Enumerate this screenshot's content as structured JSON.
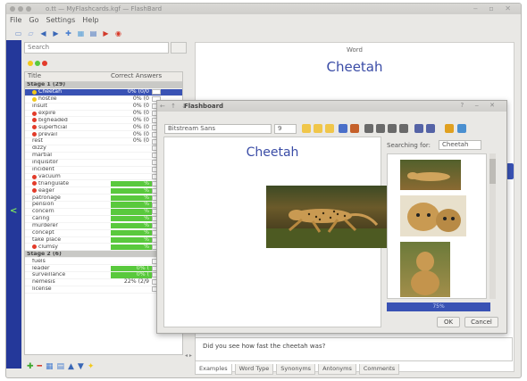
{
  "window": {
    "title": "o.tt — MyFlashcards.kgf — FlashBard"
  },
  "menu": [
    "File",
    "Go",
    "Settings",
    "Help"
  ],
  "toolbar": {
    "buttons": [
      {
        "icon": "new-doc-icon",
        "color": "#6f8fc9"
      },
      {
        "icon": "open-icon",
        "color": "#8aa5d6"
      },
      {
        "icon": "back-icon",
        "color": "#3a67b6"
      },
      {
        "icon": "forward-icon",
        "color": "#3a67b6"
      },
      {
        "icon": "add-card-icon",
        "color": "#4a7fd0"
      },
      {
        "icon": "grid-icon",
        "color": "#5aa0d8"
      },
      {
        "icon": "deck-icon",
        "color": "#3f6fc0"
      },
      {
        "icon": "play-icon",
        "color": "#d23a2b"
      },
      {
        "icon": "lifebuoy-icon",
        "color": "#d83b2b"
      }
    ]
  },
  "search": {
    "placeholder": "Search"
  },
  "colors": {
    "accent": "#3952b4",
    "green": "#59c93d",
    "red": "#e23b2a"
  },
  "deck": {
    "headers": {
      "title": "Title",
      "answers": "Correct Answers"
    },
    "rows": [
      {
        "name": "Stage 1 (29)",
        "ans": "",
        "type": "group"
      },
      {
        "name": "Cheetah",
        "ans": "0% (0/0",
        "type": "sel",
        "dot": "yellow"
      },
      {
        "name": "hostile",
        "ans": "0% (0",
        "dot": "yellow"
      },
      {
        "name": "insult",
        "ans": "0% (0"
      },
      {
        "name": "expire",
        "ans": "0% (0",
        "dot": "red"
      },
      {
        "name": "bigheaded",
        "ans": "0% (0",
        "dot": "red"
      },
      {
        "name": "superficial",
        "ans": "0% (0",
        "dot": "red"
      },
      {
        "name": "prevail",
        "ans": "0% (0",
        "dot": "red"
      },
      {
        "name": "rest",
        "ans": "0% (0"
      },
      {
        "name": "dizzy",
        "ans": "",
        "green": true
      },
      {
        "name": "martial",
        "ans": "",
        "green": true
      },
      {
        "name": "inquisitor",
        "ans": "",
        "green": true
      },
      {
        "name": "incident",
        "ans": "",
        "green": true
      },
      {
        "name": "vacuum",
        "ans": "",
        "green": true,
        "dot": "red"
      },
      {
        "name": "triangulate",
        "ans": "%",
        "green": true,
        "dot": "red"
      },
      {
        "name": "eager",
        "ans": "%",
        "green": true,
        "dot": "red"
      },
      {
        "name": "patronage",
        "ans": "%",
        "green": true
      },
      {
        "name": "pension",
        "ans": "%",
        "green": true
      },
      {
        "name": "concern",
        "ans": "%",
        "green": true
      },
      {
        "name": "caring",
        "ans": "%",
        "green": true
      },
      {
        "name": "murderer",
        "ans": "%",
        "green": true
      },
      {
        "name": "concept",
        "ans": "%",
        "green": true
      },
      {
        "name": "take place",
        "ans": "%",
        "green": true
      },
      {
        "name": "clumsy",
        "ans": "%",
        "green": true,
        "dot": "red"
      },
      {
        "name": "Stage 2 (6)",
        "ans": "",
        "type": "group"
      },
      {
        "name": "fuels",
        "ans": "",
        "green": true
      },
      {
        "name": "leader",
        "ans": "0% (",
        "green": true
      },
      {
        "name": "surveillance",
        "ans": "0% (",
        "green": true
      },
      {
        "name": "nemesis",
        "ans": "22% (2/9",
        "green": false
      },
      {
        "name": "license",
        "ans": "",
        "green": true
      }
    ]
  },
  "main": {
    "label": "Word",
    "word": "Cheetah"
  },
  "dialog": {
    "title": "Flashboard",
    "font": "Bitstream Sans",
    "size": "9",
    "word": "Cheetah",
    "searching_label": "Searching for:",
    "search_term": "Cheetah",
    "progress": "75%",
    "ok": "OK",
    "cancel": "Cancel"
  },
  "question": "Did you see how fast the cheetah was?",
  "tabs": [
    "Examples",
    "Word Type",
    "Synonyms",
    "Antonyms",
    "Comments"
  ]
}
